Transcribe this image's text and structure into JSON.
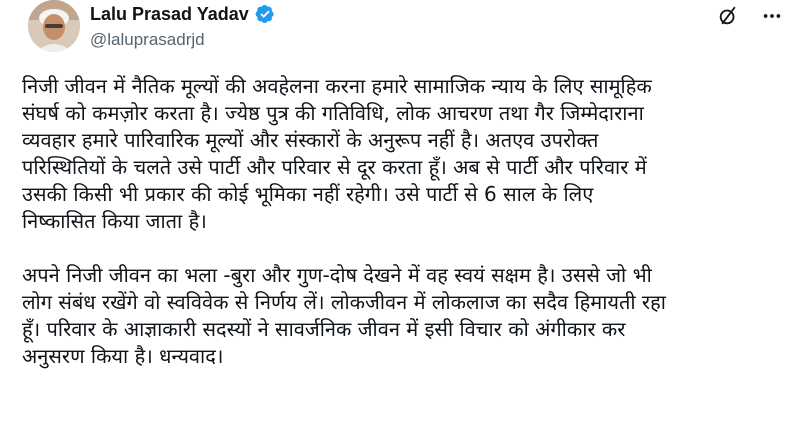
{
  "author": {
    "display_name": "Lalu Prasad Yadav",
    "handle": "@laluprasadrjd",
    "verified": true,
    "verified_color": "#1d9bf0",
    "avatar": "avatar-photo"
  },
  "header_icons": {
    "grok": "grok-icon",
    "more": "more-options-icon"
  },
  "post": {
    "paragraph_1": "निजी जीवन में नैतिक मूल्यों की अवहेलना करना हमारे सामाजिक न्याय के लिए सामूहिक\nसंघर्ष को कमज़ोर करता है। ज्येष्ठ पुत्र की गतिविधि, लोक आचरण तथा गैर जिम्मेदाराना\nव्यवहार हमारे पारिवारिक मूल्यों और संस्कारों के अनुरूप नहीं है। अतएव उपरोक्त\nपरिस्थितियों के चलते उसे पार्टी और परिवार से दूर करता हूँ। अब से पार्टी और परिवार में\nउसकी किसी भी प्रकार की कोई भूमिका नहीं रहेगी। उसे पार्टी से 6 साल के लिए\nनिष्कासित किया जाता है।",
    "paragraph_2": "अपने निजी जीवन का भला -बुरा और गुण-दोष देखने में वह स्वयं सक्षम है। उससे जो भी\nलोग संबंध रखेंगे वो स्वविवेक से निर्णय लें। लोकजीवन में लोकलाज का सदैव हिमायती रहा\nहूँ। परिवार के आज्ञाकारी सदस्यों ने सावर्जनिक जीवन में इसी विचार को अंगीकार कर\nअनुसरण किया है। धन्यवाद।"
  }
}
